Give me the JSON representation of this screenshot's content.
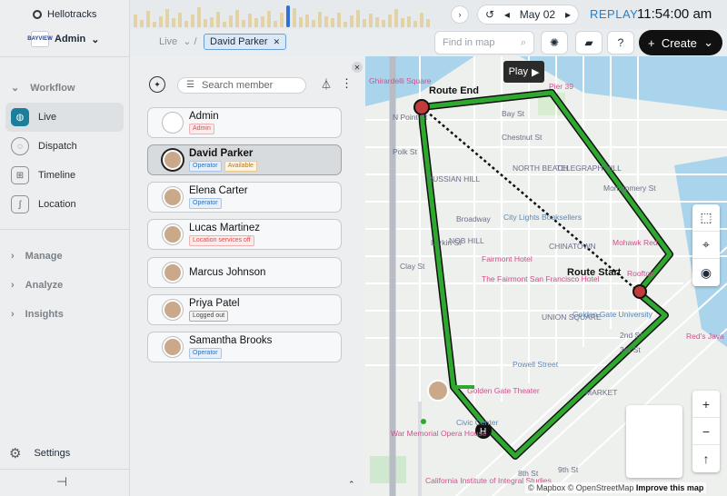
{
  "app": {
    "name": "Hellotracks",
    "account": "Admin",
    "logo_text": "BAYVIEW"
  },
  "nav": {
    "workflow": "Workflow",
    "items": [
      {
        "label": "Live",
        "icon": "globe-icon"
      },
      {
        "label": "Dispatch",
        "icon": "chat-icon"
      },
      {
        "label": "Timeline",
        "icon": "timeline-icon"
      },
      {
        "label": "Location",
        "icon": "location-icon"
      }
    ],
    "manage": "Manage",
    "analyze": "Analyze",
    "insights": "Insights",
    "settings": "Settings"
  },
  "topbar": {
    "date": "May 02",
    "mode": "REPLAY",
    "time": "11:54:00 am",
    "ticks": [
      "",
      "",
      "",
      "",
      ""
    ]
  },
  "subbar": {
    "crumb": "Live",
    "chip": "David Parker",
    "find_placeholder": "Find in map",
    "create": "Create"
  },
  "panel": {
    "search_placeholder": "Search member",
    "members": [
      {
        "name": "Admin",
        "tags": [
          {
            "text": "Admin",
            "kind": "admin"
          }
        ],
        "avatar": "logo"
      },
      {
        "name": "David Parker",
        "tags": [
          {
            "text": "Operator",
            "kind": "op"
          },
          {
            "text": "Available",
            "kind": "av"
          }
        ],
        "avatar": "photo"
      },
      {
        "name": "Elena Carter",
        "tags": [
          {
            "text": "Operator",
            "kind": "op"
          }
        ],
        "avatar": "photo"
      },
      {
        "name": "Lucas Martinez",
        "tags": [
          {
            "text": "Location services off",
            "kind": "loc"
          }
        ],
        "avatar": "photo"
      },
      {
        "name": "Marcus Johnson",
        "tags": [],
        "avatar": "photo"
      },
      {
        "name": "Priya Patel",
        "tags": [
          {
            "text": "Logged out",
            "kind": "out"
          }
        ],
        "avatar": "photo"
      },
      {
        "name": "Samantha Brooks",
        "tags": [
          {
            "text": "Operator",
            "kind": "op"
          }
        ],
        "avatar": "photo"
      }
    ]
  },
  "map": {
    "play": "Play",
    "route_end": "Route End",
    "route_start": "Route Start",
    "attribution_mapbox": "© Mapbox",
    "attribution_osm": "© OpenStreetMap",
    "improve": "Improve this map",
    "labels": [
      {
        "t": "Bay St",
        "c": ""
      },
      {
        "t": "Chestnut St",
        "c": ""
      },
      {
        "t": "NORTH BEACH",
        "c": ""
      },
      {
        "t": "TELEGRAPH HILL",
        "c": ""
      },
      {
        "t": "RUSSIAN HILL",
        "c": ""
      },
      {
        "t": "Broadway",
        "c": ""
      },
      {
        "t": "City Lights Booksellers",
        "c": "b"
      },
      {
        "t": "NOB HILL",
        "c": ""
      },
      {
        "t": "CHINATOWN",
        "c": ""
      },
      {
        "t": "The Fairmont San Francisco Hotel",
        "c": "pk"
      },
      {
        "t": "Clay St",
        "c": ""
      },
      {
        "t": "Larkin St",
        "c": ""
      },
      {
        "t": "Polk St",
        "c": ""
      },
      {
        "t": "UNION SQUARE",
        "c": ""
      },
      {
        "t": "Golden Gate University",
        "c": "b"
      },
      {
        "t": "Powell Street",
        "c": "b"
      },
      {
        "t": "Golden Gate Theater",
        "c": "pk"
      },
      {
        "t": "MARKET",
        "c": ""
      },
      {
        "t": "War Memorial Opera House",
        "c": "pk"
      },
      {
        "t": "Civic Center",
        "c": "b"
      },
      {
        "t": "California Institute of Integral Studies",
        "c": "pk"
      },
      {
        "t": "Mohawk Red",
        "c": "pk"
      },
      {
        "t": "Red's Java",
        "c": "pk"
      },
      {
        "t": "Rooftop",
        "c": "pk"
      },
      {
        "t": "Fairmont Hotel",
        "c": "pk"
      },
      {
        "t": "N Point St",
        "c": ""
      },
      {
        "t": "3rd St",
        "c": ""
      },
      {
        "t": "8th St",
        "c": ""
      },
      {
        "t": "2nd St",
        "c": ""
      },
      {
        "t": "9th St",
        "c": ""
      },
      {
        "t": "Montgomery St",
        "c": ""
      },
      {
        "t": "Pier 39",
        "c": "pk"
      },
      {
        "t": "Ghirardelli Square",
        "c": "pk"
      }
    ]
  },
  "colors": {
    "accent": "#1b7f9c",
    "route": "#2fa82f",
    "replay": "#2b7fc2"
  }
}
